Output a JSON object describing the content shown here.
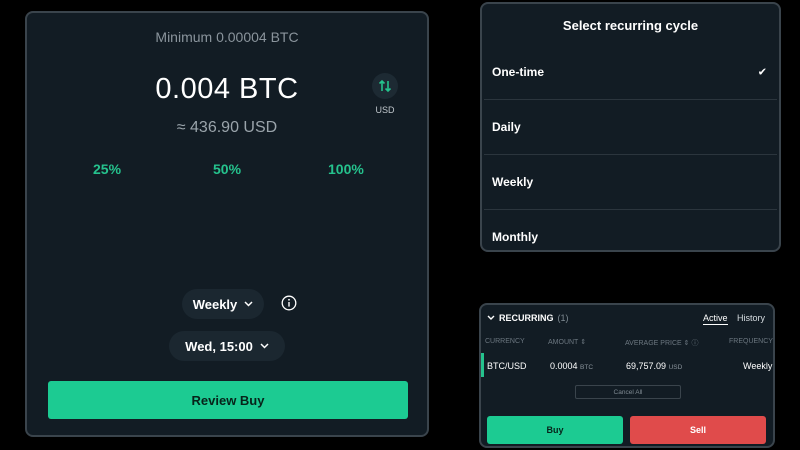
{
  "buy": {
    "minimum": "Minimum 0.00004 BTC",
    "amount": "0.004 BTC",
    "approx": "≈ 436.90 USD",
    "toggle_label": "USD",
    "percentages": [
      "25%",
      "50%",
      "100%"
    ],
    "cycle": "Weekly",
    "schedule": "Wed, 15:00",
    "review_label": "Review Buy"
  },
  "cycle_selector": {
    "title": "Select recurring cycle",
    "options": [
      "One-time",
      "Daily",
      "Weekly",
      "Monthly"
    ],
    "selected": "One-time"
  },
  "recurring": {
    "title": "RECURRING",
    "count": "(1)",
    "tabs": [
      "Active",
      "History"
    ],
    "columns": [
      "CURRENCY",
      "AMOUNT",
      "AVERAGE PRICE",
      "FREQUENCY"
    ],
    "row": {
      "currency": "BTC/USD",
      "amount": "0.0004",
      "amount_unit": "BTC",
      "avg_price": "69,757.09",
      "avg_price_unit": "USD",
      "frequency": "Weekly"
    },
    "cancel_all": "Cancel All",
    "buy_label": "Buy",
    "sell_label": "Sell"
  },
  "colors": {
    "accent_green": "#1ccb92",
    "sell_red": "#e04b4b",
    "panel_bg": "#121c24"
  }
}
